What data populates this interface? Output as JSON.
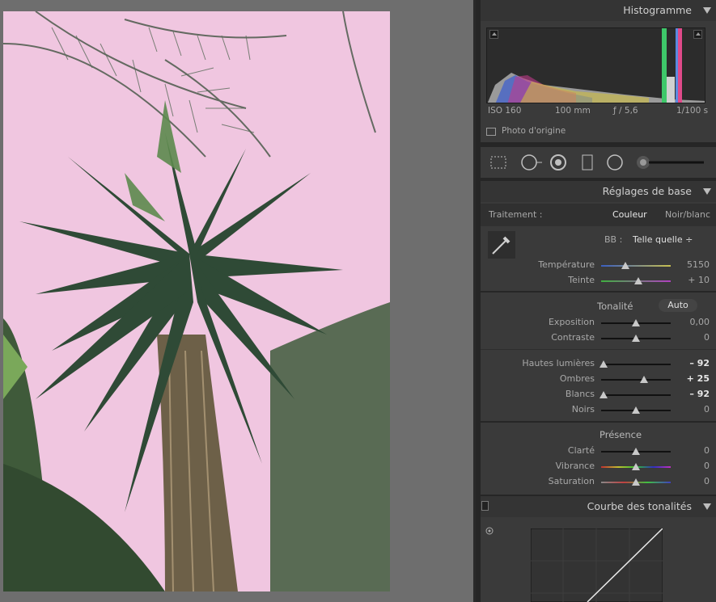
{
  "histogram": {
    "title": "Histogramme",
    "iso": "ISO 160",
    "focal": "100 mm",
    "aperture": "ƒ / 5,6",
    "shutter": "1/100 s",
    "original_photo": "Photo d'origine"
  },
  "tools": [
    "crop-icon",
    "spot-removal-icon",
    "red-eye-icon",
    "graduated-filter-icon",
    "radial-filter-icon",
    "adjustment-brush-icon"
  ],
  "basic": {
    "title": "Réglages de base",
    "treatment_label": "Traitement :",
    "color": "Couleur",
    "bw": "Noir/blanc",
    "wb_label": "BB :",
    "wb_value": "Telle quelle ÷",
    "tonality": "Tonalité",
    "auto": "Auto",
    "presence": "Présence",
    "sliders": [
      {
        "label": "Température",
        "value": "5150",
        "pos": 0.35
      },
      {
        "label": "Teinte",
        "value": "+ 10",
        "pos": 0.54
      },
      {
        "label": "Exposition",
        "value": "0,00",
        "pos": 0.5
      },
      {
        "label": "Contraste",
        "value": "0",
        "pos": 0.5
      },
      {
        "label": "Hautes lumières",
        "value": "– 92",
        "pos": 0.04
      },
      {
        "label": "Ombres",
        "value": "+ 25",
        "pos": 0.62
      },
      {
        "label": "Blancs",
        "value": "– 92",
        "pos": 0.04
      },
      {
        "label": "Noirs",
        "value": "0",
        "pos": 0.5
      },
      {
        "label": "Clarté",
        "value": "0",
        "pos": 0.5
      },
      {
        "label": "Vibrance",
        "value": "0",
        "pos": 0.5
      },
      {
        "label": "Saturation",
        "value": "0",
        "pos": 0.5
      }
    ]
  },
  "curve": {
    "title": "Courbe des tonalités"
  }
}
